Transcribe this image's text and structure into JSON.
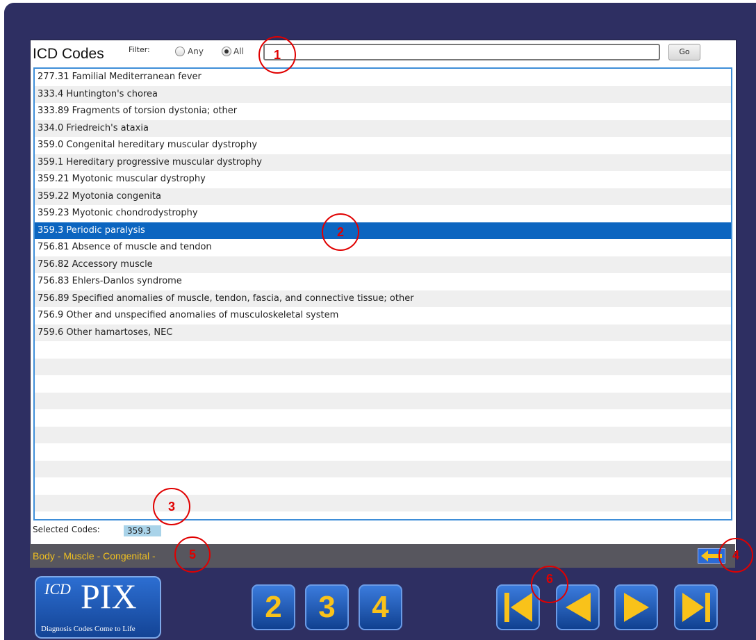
{
  "header": {
    "title": "ICD Codes",
    "filter_label": "Filter:",
    "filter_options": [
      "Any",
      "All"
    ],
    "selected_filter": "All",
    "search_value": "",
    "go_label": "Go"
  },
  "codes": [
    "277.31 Familial Mediterranean fever",
    "333.4 Huntington's chorea",
    "333.89 Fragments of torsion dystonia; other",
    "334.0 Friedreich's ataxia",
    "359.0 Congenital hereditary muscular dystrophy",
    "359.1 Hereditary progressive muscular dystrophy",
    "359.21 Myotonic muscular dystrophy",
    "359.22 Myotonia congenita",
    "359.23 Myotonic chondrodystrophy",
    "359.3 Periodic paralysis",
    "756.81 Absence of muscle and tendon",
    "756.82 Accessory muscle",
    "756.83 Ehlers-Danlos syndrome",
    "756.89 Specified anomalies of muscle, tendon, fascia, and connective tissue; other",
    "756.9 Other and unspecified anomalies of musculoskeletal system",
    "759.6 Other hamartoses, NEC"
  ],
  "selected_index": 9,
  "selected_codes_label": "Selected Codes:",
  "selected_codes_value": "359.3",
  "breadcrumb": "Body - Muscle - Congenital -",
  "logo": {
    "prefix": "ICD",
    "main": "PIX",
    "tagline": "Diagnosis Codes Come to Life"
  },
  "page_buttons": [
    "2",
    "3",
    "4"
  ],
  "annotations": [
    "1",
    "2",
    "3",
    "4",
    "5",
    "6"
  ],
  "colors": {
    "frame": "#2e2f62",
    "selection": "#0c65c0",
    "accent": "#f9c21a",
    "annotation": "#e00000"
  }
}
